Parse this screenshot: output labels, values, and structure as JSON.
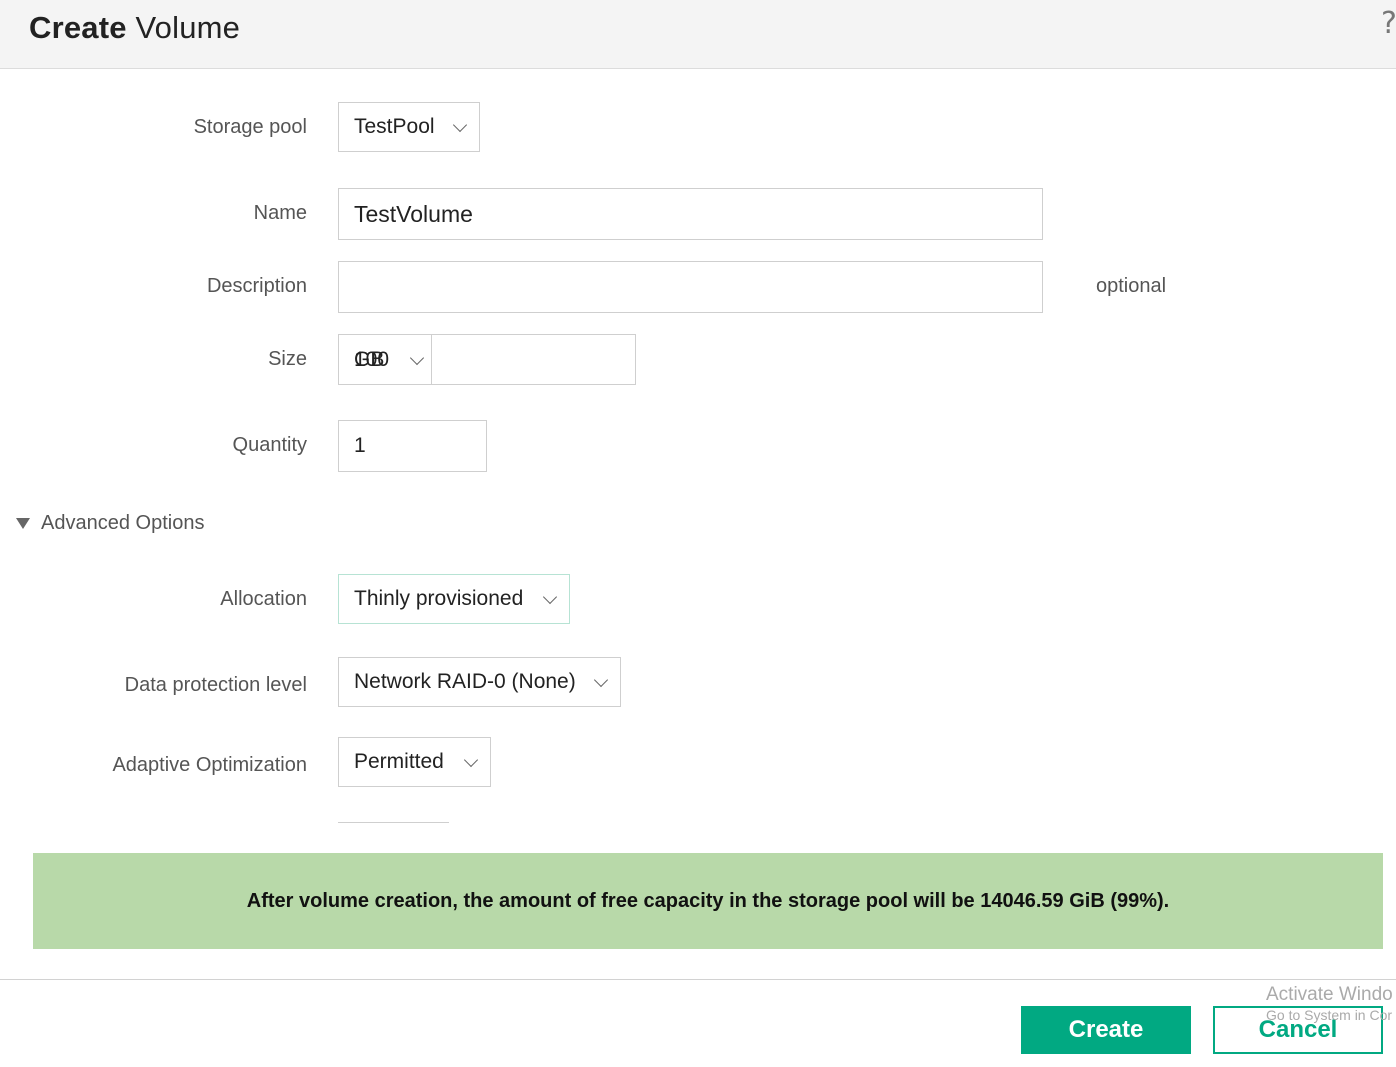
{
  "dialog": {
    "title_bold": "Create",
    "title_rest": " Volume",
    "help": "?"
  },
  "form": {
    "storage_pool": {
      "label": "Storage pool",
      "value": "TestPool"
    },
    "name": {
      "label": "Name",
      "value": "TestVolume"
    },
    "description": {
      "label": "Description",
      "value": "",
      "hint": "optional"
    },
    "size": {
      "label": "Size",
      "unit_glyphs": [
        "GB",
        "100"
      ],
      "amount": ""
    },
    "quantity": {
      "label": "Quantity",
      "value": "1"
    }
  },
  "advanced": {
    "toggle_label": "Advanced Options",
    "allocation": {
      "label": "Allocation",
      "value": "Thinly provisioned"
    },
    "data_protection": {
      "label": "Data protection level",
      "value": "Network RAID-0 (None)"
    },
    "adaptive_optimization": {
      "label": "Adaptive Optimization",
      "value": "Permitted"
    }
  },
  "banner": {
    "message": "After volume creation, the amount of free capacity in the storage pool will be 14046.59 GiB (99%)."
  },
  "footer": {
    "create_label": "Create",
    "cancel_label": "Cancel"
  },
  "watermark": {
    "line1": "Activate Windo",
    "line2": "Go to System in Cor"
  },
  "colors": {
    "accent": "#01a982",
    "banner_bg": "#b8d9a9",
    "header_bg": "#f4f4f4"
  }
}
